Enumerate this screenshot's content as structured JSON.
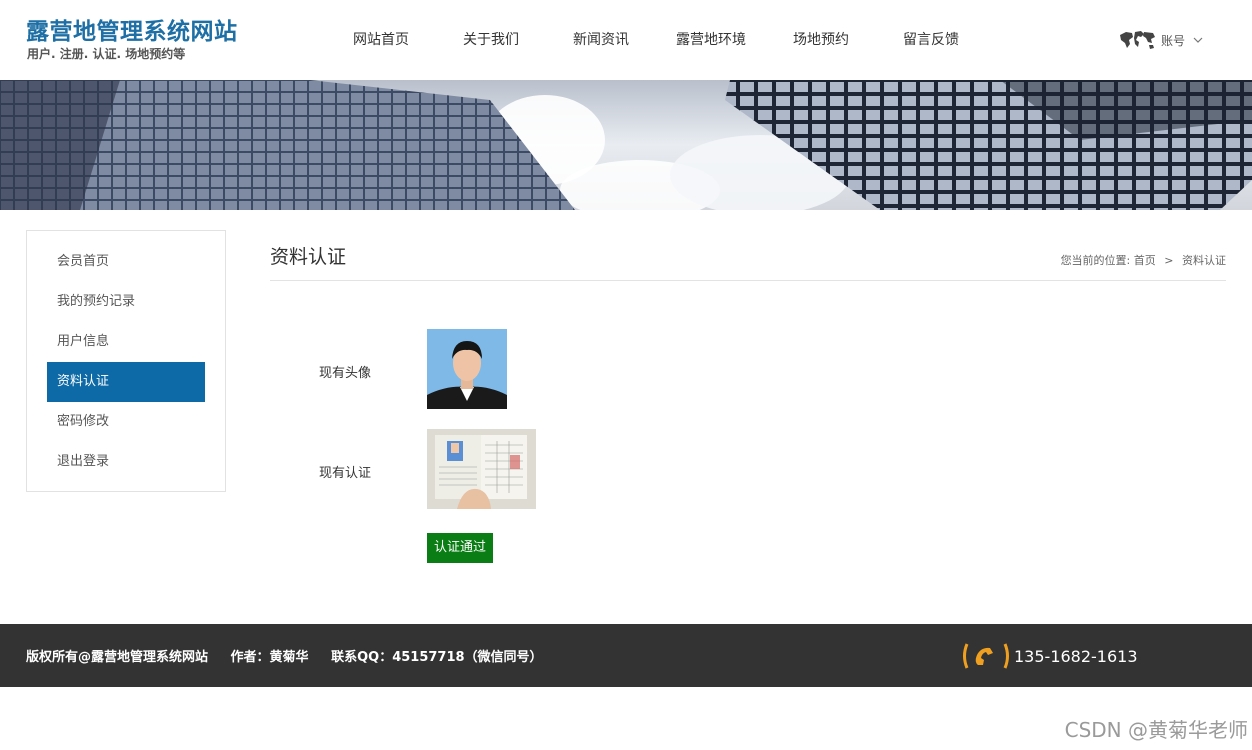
{
  "site": {
    "title": "露营地管理系统网站",
    "subtitle": "用户. 注册. 认证. 场地预约等"
  },
  "nav": {
    "items": [
      {
        "label": "网站首页"
      },
      {
        "label": "关于我们"
      },
      {
        "label": "新闻资讯"
      },
      {
        "label": "露营地环境"
      },
      {
        "label": "场地预约"
      },
      {
        "label": "留言反馈"
      }
    ]
  },
  "account": {
    "label": "账号"
  },
  "sidebar": {
    "items": [
      {
        "label": "会员首页"
      },
      {
        "label": "我的预约记录"
      },
      {
        "label": "用户信息"
      },
      {
        "label": "资料认证"
      },
      {
        "label": "密码修改"
      },
      {
        "label": "退出登录"
      }
    ],
    "active_index": 3
  },
  "main": {
    "title": "资料认证",
    "breadcrumb": {
      "prefix": "您当前的位置:",
      "home": "首页",
      "separator": ">",
      "current": "资料认证"
    },
    "avatar_label": "现有头像",
    "cert_label": "现有认证",
    "status": "认证通过"
  },
  "footer": {
    "copyright": "版权所有@露营地管理系统网站",
    "author": "作者：黄菊华",
    "contact": "联系QQ：45157718（微信同号）",
    "phone": "135-1682-1613"
  },
  "watermark": "CSDN @黄菊华老师",
  "colors": {
    "brand": "#1d6fa5",
    "active_menu": "#0e6aa6",
    "status_green": "#0a7d14",
    "footer_bg": "#333333",
    "phone_icon": "#f0a020"
  },
  "icons": {
    "account": "world-map-icon",
    "dropdown": "chevron-down-icon",
    "phone": "phone-icon"
  }
}
